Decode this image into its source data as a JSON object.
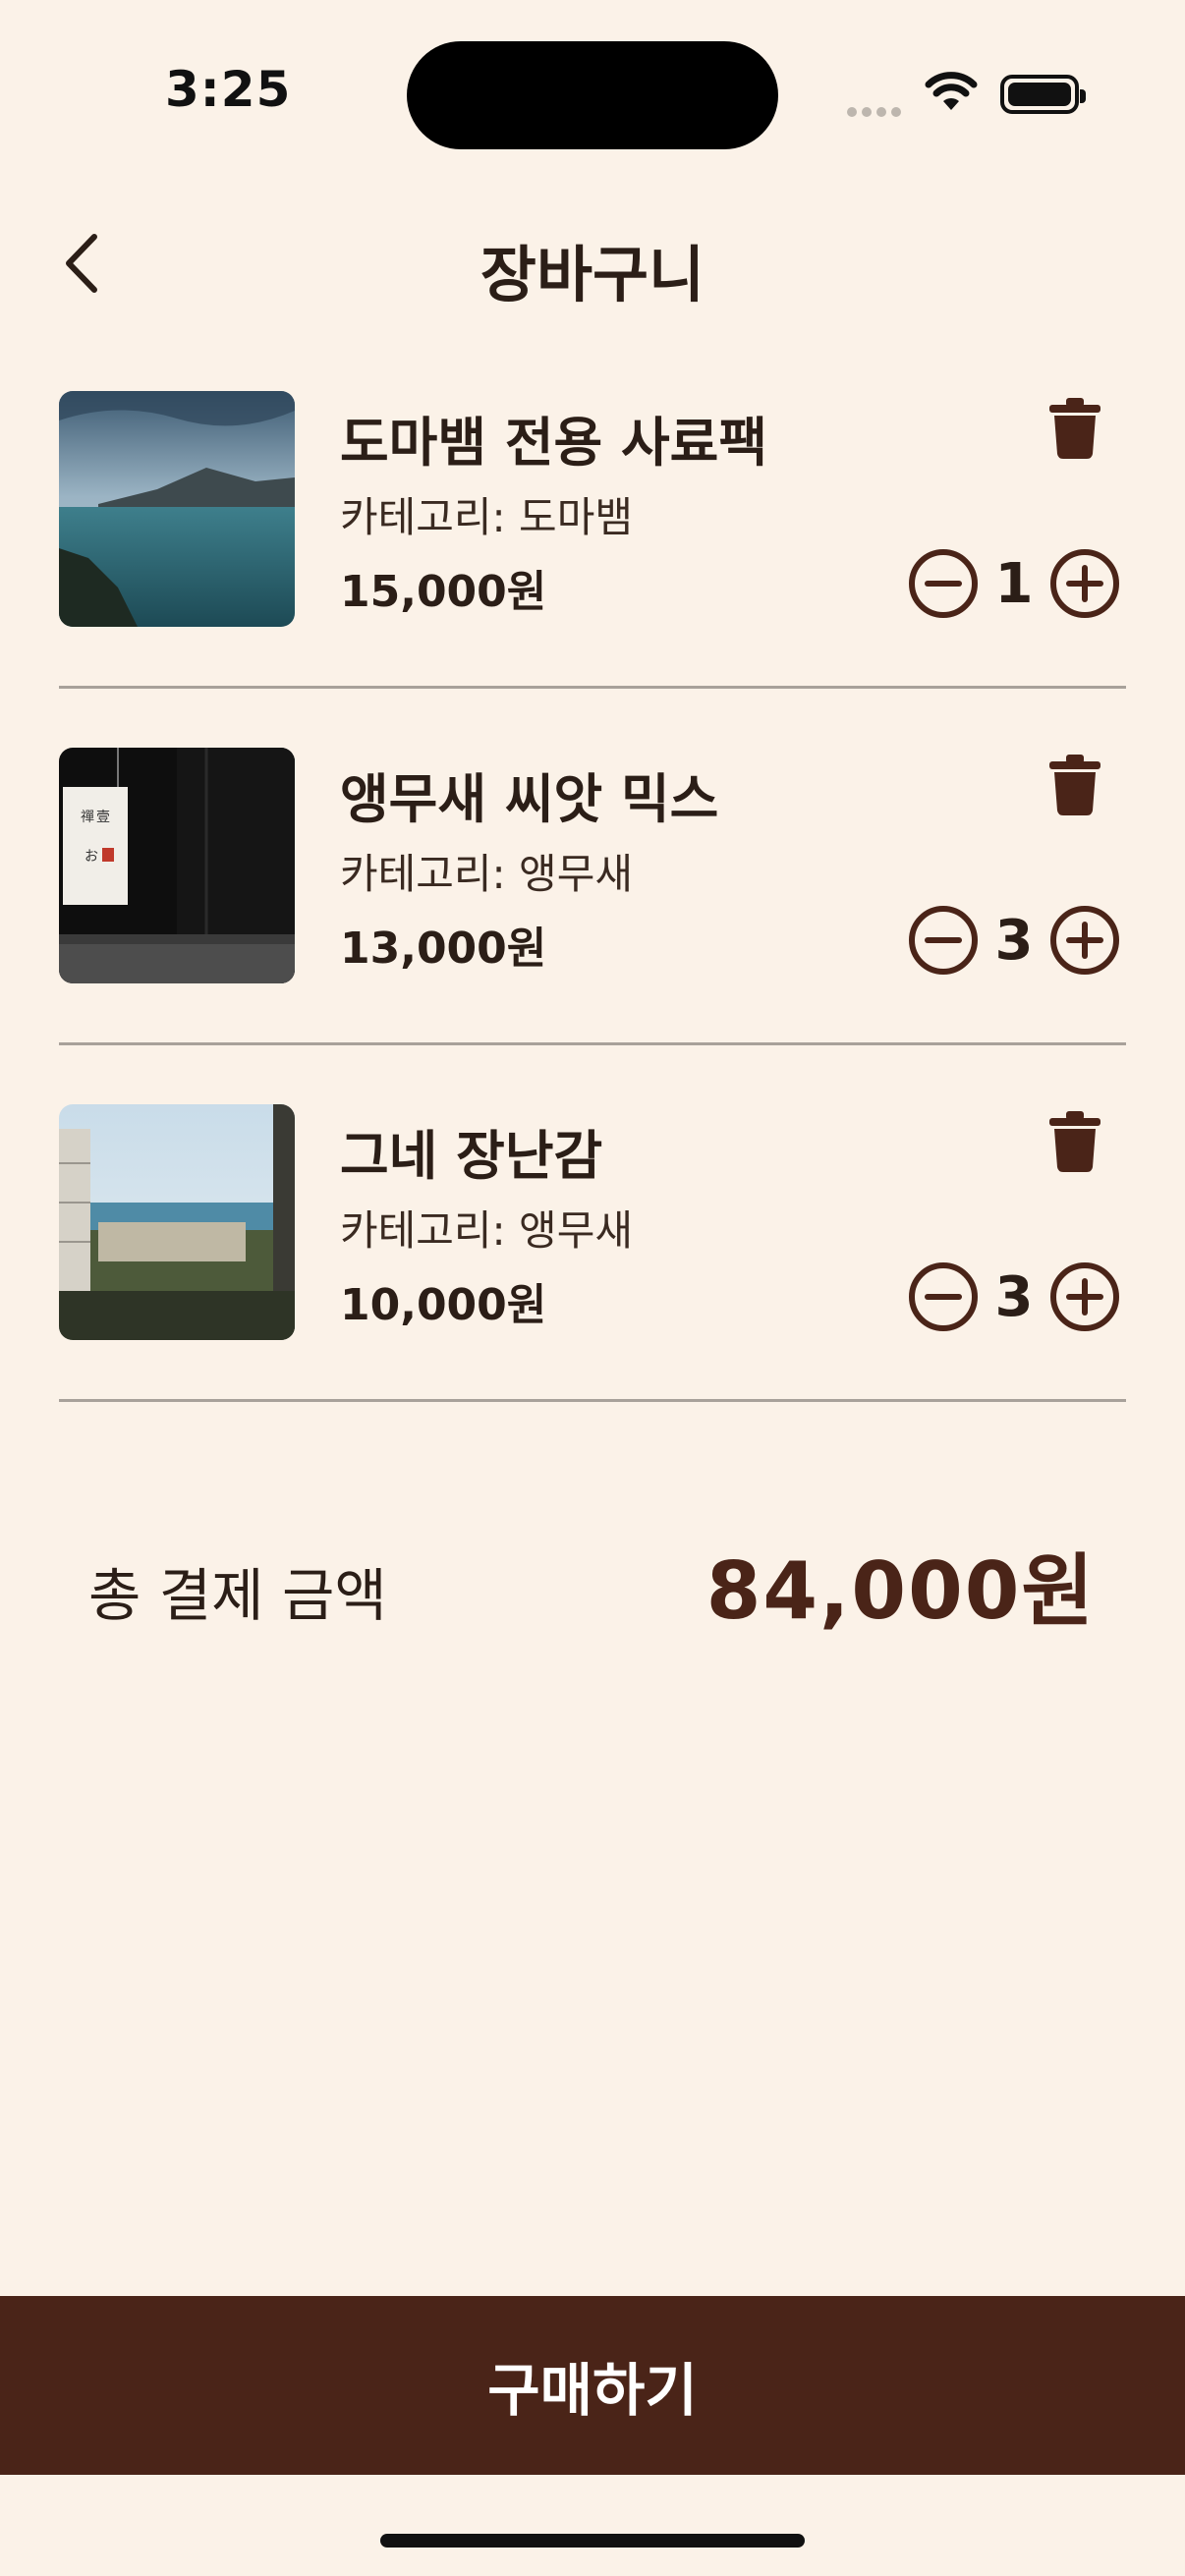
{
  "status": {
    "time": "3:25"
  },
  "header": {
    "title": "장바구니"
  },
  "items": [
    {
      "name": "도마뱀 전용 사료팩",
      "category": "카테고리: 도마뱀",
      "price": "15,000원",
      "quantity": "1",
      "image": "lake-landscape"
    },
    {
      "name": "앵무새 씨앗 믹스",
      "category": "카테고리: 앵무새",
      "price": "13,000원",
      "quantity": "3",
      "image": "hanging-lantern"
    },
    {
      "name": "그네 장난감",
      "category": "카테고리: 앵무새",
      "price": "10,000원",
      "quantity": "3",
      "image": "coastal-city"
    }
  ],
  "summary": {
    "total_label": "총 결제 금액",
    "total_value": "84,000원"
  },
  "actions": {
    "buy_label": "구매하기"
  },
  "colors": {
    "background": "#FBF2E8",
    "accent": "#4A2418",
    "text": "#2B1E17"
  }
}
